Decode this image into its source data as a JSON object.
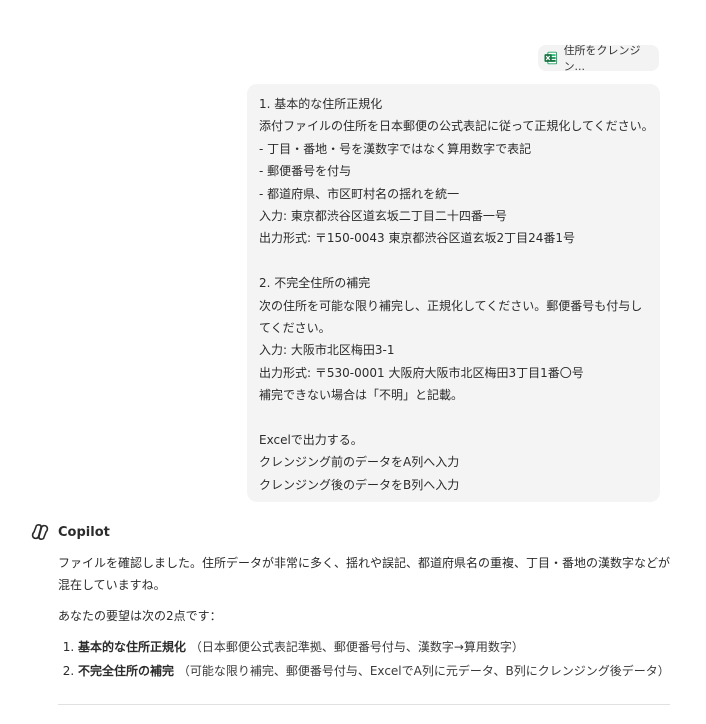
{
  "attachment": {
    "icon": "excel-file-icon",
    "label": "住所をクレンジン..."
  },
  "user_message": {
    "lines": [
      "1. 基本的な住所正規化",
      "添付ファイルの住所を日本郵便の公式表記に従って正規化してください。",
      "- 丁目・番地・号を漢数字ではなく算用数字で表記",
      "- 郵便番号を付与",
      "- 都道府県、市区町村名の揺れを統一",
      "入力: 東京都渋谷区道玄坂二丁目二十四番一号",
      "出力形式: 〒150-0043 東京都渋谷区道玄坂2丁目24番1号",
      "",
      "2. 不完全住所の補完",
      "次の住所を可能な限り補完し、正規化してください。郵便番号も付与してください。",
      "入力: 大阪市北区梅田3-1",
      "出力形式: 〒530-0001 大阪府大阪市北区梅田3丁目1番〇号",
      "補完できない場合は「不明」と記載。",
      "",
      "Excelで出力する。",
      "クレンジング前のデータをA列へ入力",
      "クレンジング後のデータをB列へ入力"
    ]
  },
  "assistant": {
    "name": "Copilot",
    "paragraph1": "ファイルを確認しました。住所データが非常に多く、揺れや誤記、都道府県名の重複、丁目・番地の漢数字などが混在していますね。",
    "paragraph2": "あなたの要望は次の2点です：",
    "items": [
      {
        "title": "基本的な住所正規化",
        "detail": "（日本郵便公式表記準拠、郵便番号付与、漢数字→算用数字）"
      },
      {
        "title": "不完全住所の補完",
        "detail": "（可能な限り補完、郵便番号付与、ExcelでA列に元データ、B列にクレンジング後データ）"
      }
    ]
  },
  "colors": {
    "bubble_bg": "#f4f4f4",
    "chip_bg": "#f3f3f3",
    "excel_green": "#1e7145",
    "text": "#2b2b2b"
  }
}
